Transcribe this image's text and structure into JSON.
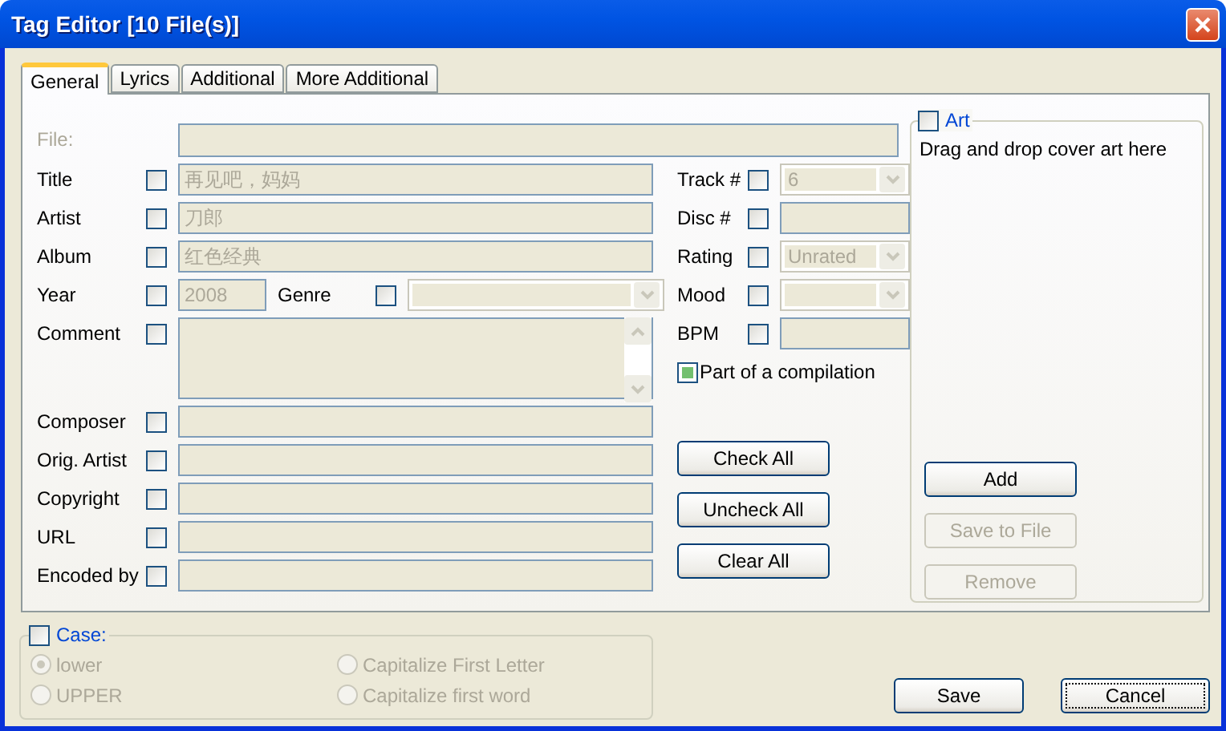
{
  "window": {
    "title": "Tag Editor [10 File(s)]"
  },
  "tabs": [
    {
      "label": "General",
      "selected": true
    },
    {
      "label": "Lyrics",
      "selected": false
    },
    {
      "label": "Additional",
      "selected": false
    },
    {
      "label": "More Additional",
      "selected": false
    }
  ],
  "file": {
    "label": "File:"
  },
  "left_fields": [
    {
      "kind": "text",
      "label": "Title",
      "checked": false,
      "value": "再见吧，妈妈"
    },
    {
      "kind": "text",
      "label": "Artist",
      "checked": false,
      "value": "刀郎"
    },
    {
      "kind": "text",
      "label": "Album",
      "checked": false,
      "value": "红色经典"
    },
    {
      "kind": "year",
      "label": "Year",
      "checked": false,
      "value": "2008",
      "genre": {
        "label": "Genre",
        "checked": false
      }
    },
    {
      "kind": "multiline",
      "label": "Comment",
      "checked": false
    },
    {
      "kind": "text",
      "label": "Composer",
      "checked": false
    },
    {
      "kind": "text",
      "label": "Orig. Artist",
      "checked": false
    },
    {
      "kind": "text",
      "label": "Copyright",
      "checked": false
    },
    {
      "kind": "text",
      "label": "URL",
      "checked": false
    },
    {
      "kind": "text",
      "label": "Encoded by",
      "checked": false
    }
  ],
  "right_fields": [
    {
      "kind": "combo",
      "label": "Track #",
      "checked": false,
      "value": "6"
    },
    {
      "kind": "text",
      "label": "Disc #",
      "checked": false
    },
    {
      "kind": "combo",
      "label": "Rating",
      "checked": false,
      "value": "Unrated"
    },
    {
      "kind": "combo",
      "label": "Mood",
      "checked": false
    },
    {
      "kind": "text",
      "label": "BPM",
      "checked": false
    }
  ],
  "compilation": {
    "label": "Part of a compilation",
    "indeterminate": true
  },
  "action_buttons": [
    "Check All",
    "Uncheck All",
    "Clear All"
  ],
  "art": {
    "label": "Art",
    "checked": false,
    "hint": "Drag and drop cover art here",
    "buttons": [
      {
        "label": "Add",
        "disabled": false
      },
      {
        "label": "Save to File",
        "disabled": true
      },
      {
        "label": "Remove",
        "disabled": true
      }
    ]
  },
  "case": {
    "label": "Case:",
    "checked": false,
    "options": [
      {
        "label": "lower",
        "selected": true
      },
      {
        "label": "Capitalize First Letter",
        "selected": false
      },
      {
        "label": "UPPER",
        "selected": false
      },
      {
        "label": "Capitalize first word",
        "selected": false
      }
    ]
  },
  "dialog_buttons": [
    {
      "label": "Save",
      "focused": false
    },
    {
      "label": "Cancel",
      "focused": true
    }
  ]
}
